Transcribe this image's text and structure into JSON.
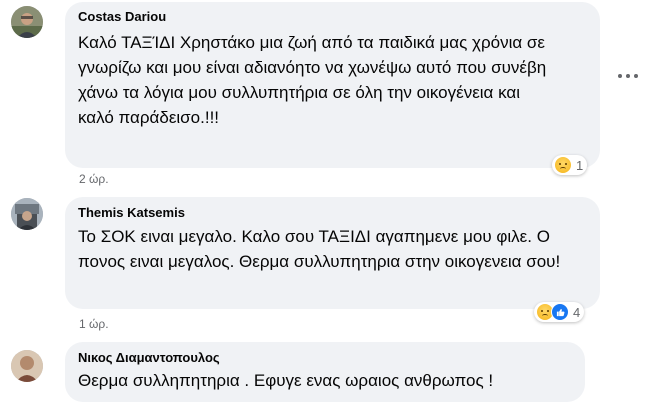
{
  "comments": [
    {
      "author": "Costas Dariou",
      "text": "Καλό ΤΑΞΊΔΙ Χρηστάκο μια ζωή από τα παιδικά μας χρόνια σε γνωρίζω και μου είναι αδιανόητο να χωνέψω αυτό που συνέβη χάνω τα λόγια μου συλλυπητήρια σε όλη την οικογένεια και καλό παράδεισο.!!!",
      "time": "2 ώρ.",
      "reactions": [
        "sad"
      ],
      "reaction_count": "1"
    },
    {
      "author": "Themis Katsemis",
      "text": "Το ΣΟΚ ειναι μεγαλο. Καλο σου ΤΑΞΙΔΙ αγαπημενε μου φιλε. Ο πονος ειναι μεγαλος. Θερμα συλλυπητηρια στην οικογενεια σου!",
      "time": "1 ώρ.",
      "reactions": [
        "sad",
        "like"
      ],
      "reaction_count": "4"
    },
    {
      "author": "Νικος Διαμαντοπουλος",
      "text": "Θερμα συλληπητηρια . Εφυγε ενας ωραιος ανθρωπος !",
      "time": "",
      "reactions": [],
      "reaction_count": ""
    }
  ],
  "icons": {
    "more": "more-options-icon",
    "sad": "sad-reaction-icon",
    "like": "like-reaction-icon"
  },
  "colors": {
    "bubble": "#f0f2f5",
    "meta_text": "#65676b",
    "like_blue": "#1877f2",
    "sad_yellow": "#f5b316"
  }
}
